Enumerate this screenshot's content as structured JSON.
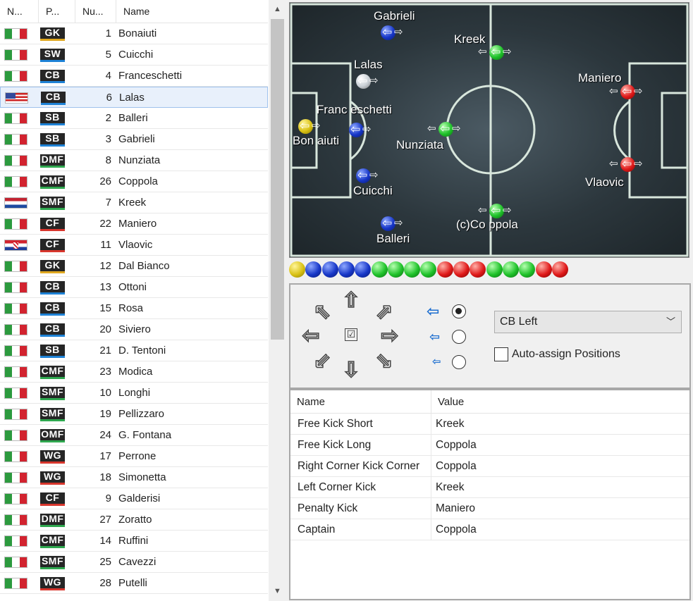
{
  "roster": {
    "columns": [
      "N...",
      "P...",
      "Nu...",
      "Name"
    ],
    "players": [
      {
        "flag": "italy",
        "pos": "GK",
        "num": "1",
        "name": "Bonaiuti"
      },
      {
        "flag": "italy",
        "pos": "SW",
        "num": "5",
        "name": "Cuicchi"
      },
      {
        "flag": "italy",
        "pos": "CB",
        "num": "4",
        "name": "Franceschetti"
      },
      {
        "flag": "usa",
        "pos": "CB",
        "num": "6",
        "name": "Lalas",
        "selected": true
      },
      {
        "flag": "italy",
        "pos": "SB",
        "num": "2",
        "name": "Balleri"
      },
      {
        "flag": "italy",
        "pos": "SB",
        "num": "3",
        "name": "Gabrieli"
      },
      {
        "flag": "italy",
        "pos": "DMF",
        "num": "8",
        "name": "Nunziata"
      },
      {
        "flag": "italy",
        "pos": "CMF",
        "num": "26",
        "name": "Coppola"
      },
      {
        "flag": "netherlands",
        "pos": "SMF",
        "num": "7",
        "name": "Kreek"
      },
      {
        "flag": "italy",
        "pos": "CF",
        "num": "22",
        "name": "Maniero"
      },
      {
        "flag": "croatia",
        "pos": "CF",
        "num": "11",
        "name": "Vlaovic"
      },
      {
        "flag": "italy",
        "pos": "GK",
        "num": "12",
        "name": "Dal Bianco"
      },
      {
        "flag": "italy",
        "pos": "CB",
        "num": "13",
        "name": "Ottoni"
      },
      {
        "flag": "italy",
        "pos": "CB",
        "num": "15",
        "name": "Rosa"
      },
      {
        "flag": "italy",
        "pos": "CB",
        "num": "20",
        "name": "Siviero"
      },
      {
        "flag": "italy",
        "pos": "SB",
        "num": "21",
        "name": "D. Tentoni"
      },
      {
        "flag": "italy",
        "pos": "CMF",
        "num": "23",
        "name": "Modica"
      },
      {
        "flag": "italy",
        "pos": "SMF",
        "num": "10",
        "name": "Longhi"
      },
      {
        "flag": "italy",
        "pos": "SMF",
        "num": "19",
        "name": "Pellizzaro"
      },
      {
        "flag": "italy",
        "pos": "OMF",
        "num": "24",
        "name": "G. Fontana"
      },
      {
        "flag": "italy",
        "pos": "WG",
        "num": "17",
        "name": "Perrone"
      },
      {
        "flag": "italy",
        "pos": "WG",
        "num": "18",
        "name": "Simonetta"
      },
      {
        "flag": "italy",
        "pos": "CF",
        "num": "9",
        "name": "Galderisi"
      },
      {
        "flag": "italy",
        "pos": "DMF",
        "num": "27",
        "name": "Zoratto"
      },
      {
        "flag": "italy",
        "pos": "CMF",
        "num": "14",
        "name": "Ruffini"
      },
      {
        "flag": "italy",
        "pos": "SMF",
        "num": "25",
        "name": "Cavezzi"
      },
      {
        "flag": "italy",
        "pos": "WG",
        "num": "28",
        "name": "Putelli"
      }
    ]
  },
  "pitch": {
    "players": [
      {
        "label": "Bon aiuti",
        "group": "gk"
      },
      {
        "label": "Franc eschetti",
        "group": "df"
      },
      {
        "label": "Lalas",
        "group": "sel"
      },
      {
        "label": "Cuicchi",
        "group": "df"
      },
      {
        "label": "Gabrieli",
        "group": "df"
      },
      {
        "label": "Balleri",
        "group": "df"
      },
      {
        "label": "Nunziata",
        "group": "mf"
      },
      {
        "label": "Kreek",
        "group": "mf"
      },
      {
        "label": "(c)Co ppola",
        "group": "mf"
      },
      {
        "label": "Maniero",
        "group": "fw"
      },
      {
        "label": "Vlaovic",
        "group": "fw"
      }
    ]
  },
  "balls_bar": [
    "gk",
    "df",
    "df",
    "df",
    "df",
    "mf",
    "mf",
    "mf",
    "mf",
    "fw",
    "fw",
    "fw",
    "mf",
    "mf",
    "mf",
    "fw",
    "fw"
  ],
  "controls": {
    "position_select": "CB Left",
    "auto_assign_label": "Auto-assign Positions",
    "auto_assign_checked": false,
    "speed_selected": 0,
    "center_check": "☑"
  },
  "setpieces": {
    "columns": [
      "Name",
      "Value"
    ],
    "rows": [
      {
        "name": "Free Kick Short",
        "value": "Kreek"
      },
      {
        "name": "Free Kick Long",
        "value": "Coppola"
      },
      {
        "name": "Right Corner Kick Corner",
        "value": "Coppola"
      },
      {
        "name": "Left Corner Kick",
        "value": "Kreek"
      },
      {
        "name": "Penalty Kick",
        "value": "Maniero"
      },
      {
        "name": "Captain",
        "value": "Coppola"
      }
    ]
  },
  "colors": {
    "gk": "#d9c114",
    "df": "#1737c8",
    "mf": "#1fc22a",
    "fw": "#e01a1a",
    "pitch": "#2c373d",
    "selection": "#e8f0fb"
  }
}
